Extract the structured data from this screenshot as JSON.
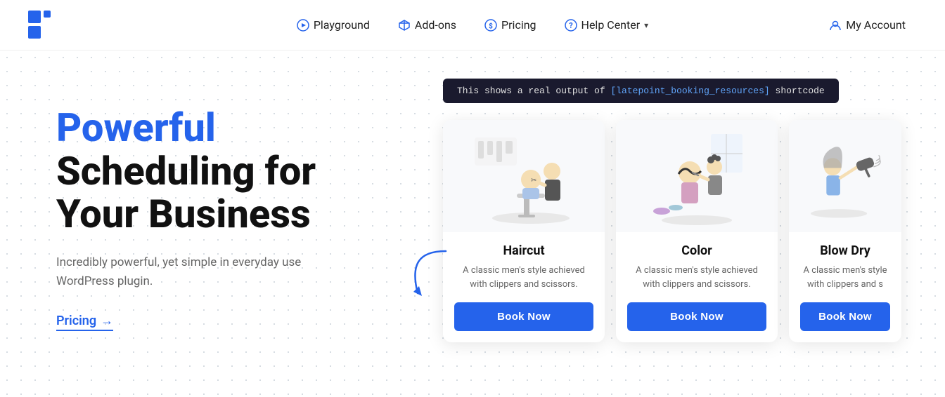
{
  "logo": {
    "alt": "LatePoint Logo"
  },
  "nav": {
    "items": [
      {
        "id": "playground",
        "label": "Playground",
        "icon": "play-circle"
      },
      {
        "id": "addons",
        "label": "Add-ons",
        "icon": "cube"
      },
      {
        "id": "pricing",
        "label": "Pricing",
        "icon": "dollar"
      },
      {
        "id": "helpcenter",
        "label": "Help Center",
        "icon": "help-circle",
        "hasDropdown": true
      },
      {
        "id": "myaccount",
        "label": "My Account",
        "icon": "user"
      }
    ]
  },
  "hero": {
    "title_accent": "Powerful",
    "title_rest": "Scheduling for\nYour Business",
    "subtitle": "Incredibly powerful, yet simple in everyday\nuse WordPress plugin.",
    "pricing_link": "Pricing",
    "pricing_arrow": "→"
  },
  "shortcode": {
    "prefix": "This shows a real output of",
    "code": "[latepoint_booking_resources]",
    "suffix": "shortcode"
  },
  "cards": [
    {
      "id": "haircut",
      "title": "Haircut",
      "description": "A classic men's style achieved with clippers and scissors.",
      "btn_label": "Book Now"
    },
    {
      "id": "color",
      "title": "Color",
      "description": "A classic men's style achieved with clippers and scissors.",
      "btn_label": "Book Now"
    },
    {
      "id": "blowdry",
      "title": "Blow Dry",
      "description": "A classic men's style with clippers and s",
      "btn_label": "Book Now"
    }
  ],
  "colors": {
    "accent": "#2563eb",
    "text_dark": "#111111",
    "text_gray": "#666666",
    "bg_white": "#ffffff"
  }
}
